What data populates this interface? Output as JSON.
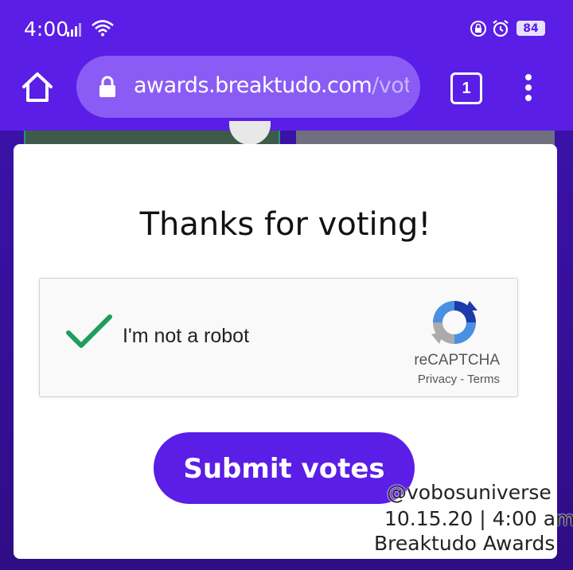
{
  "status_bar": {
    "time": "4:00",
    "battery": "84"
  },
  "browser": {
    "url_host": "awards.breaktudo.com",
    "url_path": "/vote/gru",
    "tab_count": "1"
  },
  "modal": {
    "title": "Thanks for voting!",
    "captcha": {
      "label": "I'm not a robot",
      "brand": "reCAPTCHA",
      "links": "Privacy - Terms"
    },
    "submit_label": "Submit votes"
  },
  "watermark": {
    "line1": "@vobosuniverse",
    "line2": "10.15.20 | 4:00 am",
    "line3": "Breaktudo Awards"
  },
  "colors": {
    "accent": "#5a1ee6",
    "check": "#1e9e5a"
  }
}
